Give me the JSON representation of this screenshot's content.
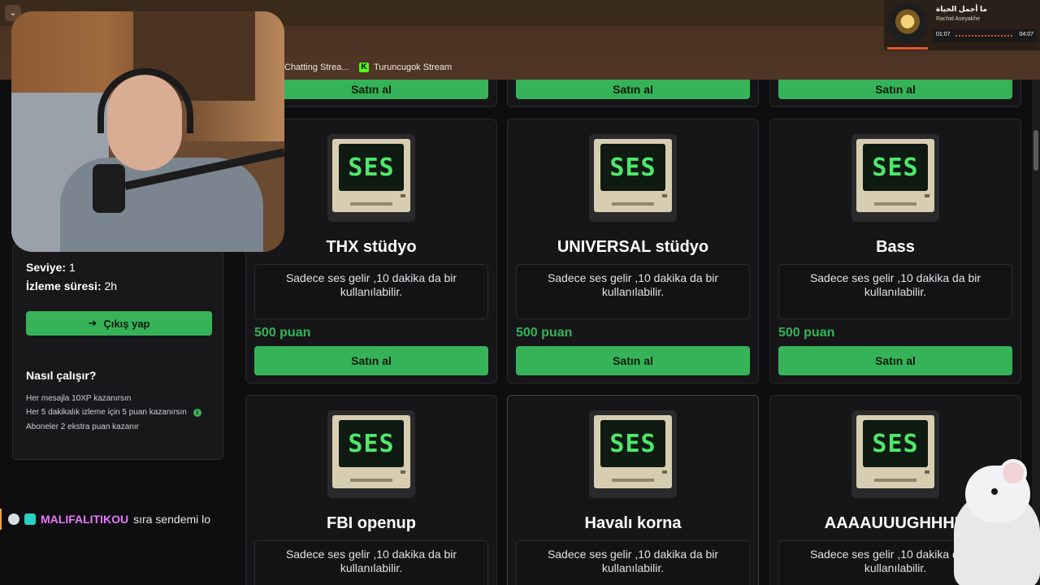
{
  "browser": {
    "bookmarks": [
      {
        "label": "Chatting Strea..."
      },
      {
        "label": "Turuncugok Stream"
      }
    ]
  },
  "media": {
    "title": "ما أجمل الحياة",
    "artist": "Rachid Aseyakhe",
    "elapsed": "01:07",
    "duration": "04:07"
  },
  "sidebar": {
    "level_label": "Seviye:",
    "level_value": "1",
    "watch_label": "İzleme süresi:",
    "watch_value": "2h",
    "logout_label": "Çıkış yap",
    "how_title": "Nasıl çalışır?",
    "how_lines": [
      "Her mesajla 10XP kazanırsın",
      "Her 5 dakikalık izleme için 5 puan kazanırsın",
      "Aboneler 2 ekstra puan kazanır"
    ]
  },
  "chat": {
    "username": "MALIFALITIKOU",
    "message": "sıra sendemi lo"
  },
  "store": {
    "buy_label": "Satın al",
    "icon_text": "SES",
    "items": [
      {
        "title": "THX stüdyo",
        "desc": "Sadece ses gelir ,10 dakika da bir kullanılabilir.",
        "price": "500 puan"
      },
      {
        "title": "UNIVERSAL stüdyo",
        "desc": "Sadece ses gelir ,10 dakika da bir kullanılabilir.",
        "price": "500 puan"
      },
      {
        "title": "Bass",
        "desc": "Sadece ses gelir ,10 dakika da bir kullanılabilir.",
        "price": "500 puan"
      },
      {
        "title": "FBI openup",
        "desc": "Sadece ses gelir ,10 dakika da bir kullanılabilir."
      },
      {
        "title": "Havalı korna",
        "desc": "Sadece ses gelir ,10 dakika da bir kullanılabilir."
      },
      {
        "title": "AAAAUUUGHHHH",
        "desc": "Sadece ses gelir ,10 dakika da bir kullanılabilir."
      }
    ]
  },
  "colors": {
    "accent": "#36b358",
    "background": "#0e0e10",
    "card": "#161618",
    "chat_user": "#e879f9"
  }
}
